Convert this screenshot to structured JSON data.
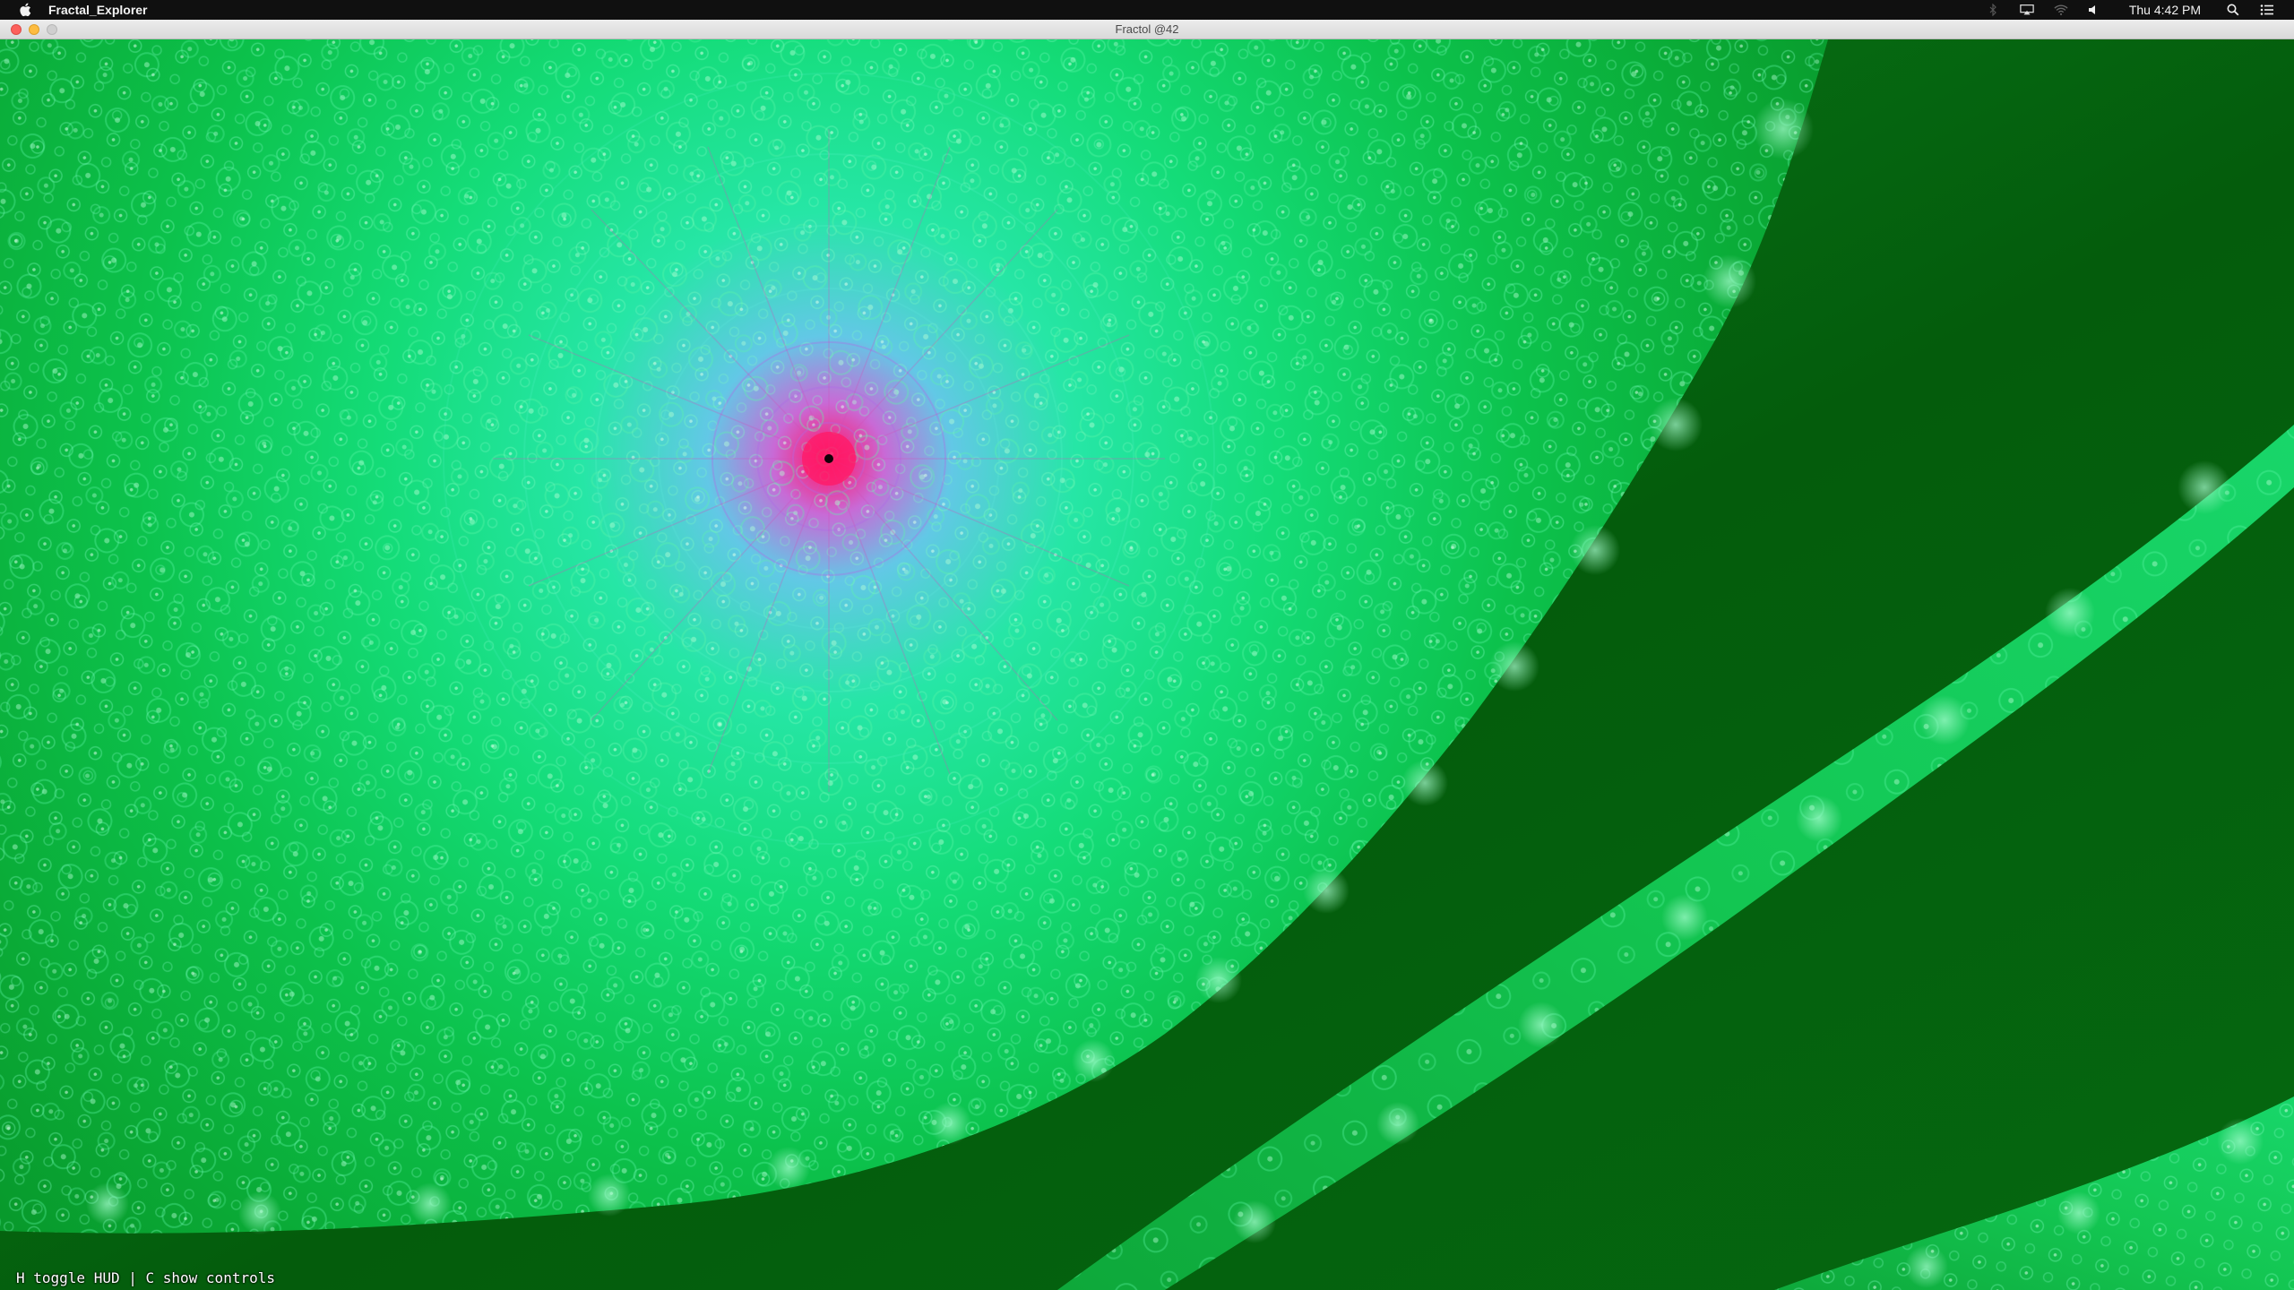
{
  "menubar": {
    "app_name": "Fractal_Explorer",
    "clock": "Thu 4:42 PM",
    "icons": [
      "apple-icon",
      "bluetooth-icon",
      "airplay-icon",
      "wifi-icon",
      "volume-icon",
      "spotlight-search-icon",
      "notification-center-icon"
    ]
  },
  "window": {
    "title": "Fractol @42",
    "buttons": [
      "close",
      "minimize",
      "zoom"
    ]
  },
  "fractal": {
    "colors": {
      "deep_background": "#025a0a",
      "mid_green": "#08b83a",
      "bright_green": "#12d860",
      "cyan": "#22e89a",
      "magenta": "#e0389c",
      "core": "#ff1060"
    }
  },
  "hud": {
    "hint": "H toggle HUD | C show controls"
  }
}
